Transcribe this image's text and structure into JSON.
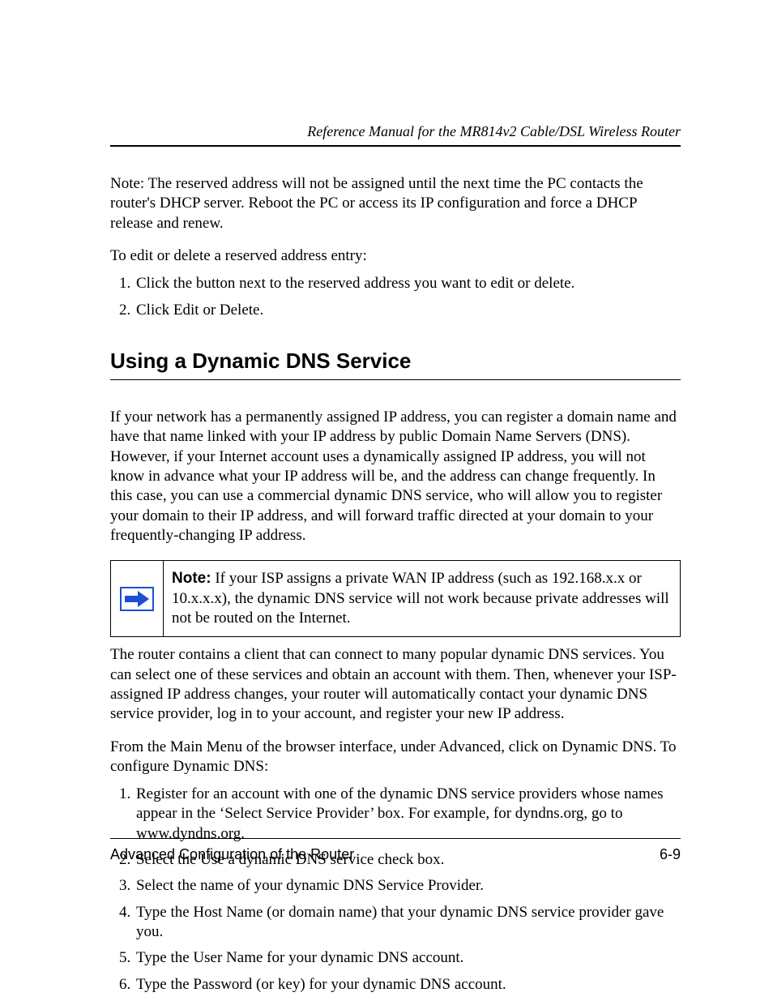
{
  "header": {
    "running_title": "Reference Manual for the MR814v2 Cable/DSL Wireless Router"
  },
  "intro": {
    "note_para": "Note: The reserved address will not be assigned until the next time the PC contacts the router's DHCP server. Reboot the PC or access its IP configuration and force a DHCP release and renew.",
    "lead_in": "To edit or delete a reserved address entry:",
    "steps": [
      "Click the button next to the reserved address you want to edit or delete.",
      "Click Edit or Delete."
    ]
  },
  "section": {
    "title": "Using a Dynamic DNS Service",
    "para1": "If your network has a permanently assigned IP address, you can register a domain name and have that name linked with your IP address by public Domain Name Servers (DNS). However, if your Internet account uses a dynamically assigned IP address, you will not know in advance what your IP address will be, and the address can change frequently. In this case, you can use a commercial dynamic DNS service, who will allow you to register your domain to their IP address, and will forward traffic directed at your domain to your frequently-changing IP address.",
    "note_label": "Note:",
    "note_body": " If your ISP assigns a private WAN IP address (such as 192.168.x.x or 10.x.x.x), the dynamic DNS service will not work because private addresses will not be routed on the Internet.",
    "para2": "The router contains a client that can connect to many popular dynamic DNS services. You can select one of these services and obtain an account with them. Then, whenever your ISP-assigned IP address changes, your router will automatically contact your dynamic DNS service provider, log in to your account, and register your new IP address.",
    "para3": "From the Main Menu of the browser interface, under Advanced, click on Dynamic DNS. To configure Dynamic DNS:",
    "steps": [
      "Register for an account with one of the dynamic DNS service providers whose names appear in the ‘Select Service Provider’ box. For example, for dyndns.org, go to www.dyndns.org.",
      "Select the Use a dynamic DNS service check box.",
      "Select the name of your dynamic DNS Service Provider.",
      "Type the Host Name (or domain name) that your dynamic DNS service provider gave you.",
      "Type the User Name for your dynamic DNS account.",
      "Type the Password (or key) for your dynamic DNS account."
    ]
  },
  "footer": {
    "left": "Advanced Configuration of the Router",
    "right": "6-9"
  }
}
